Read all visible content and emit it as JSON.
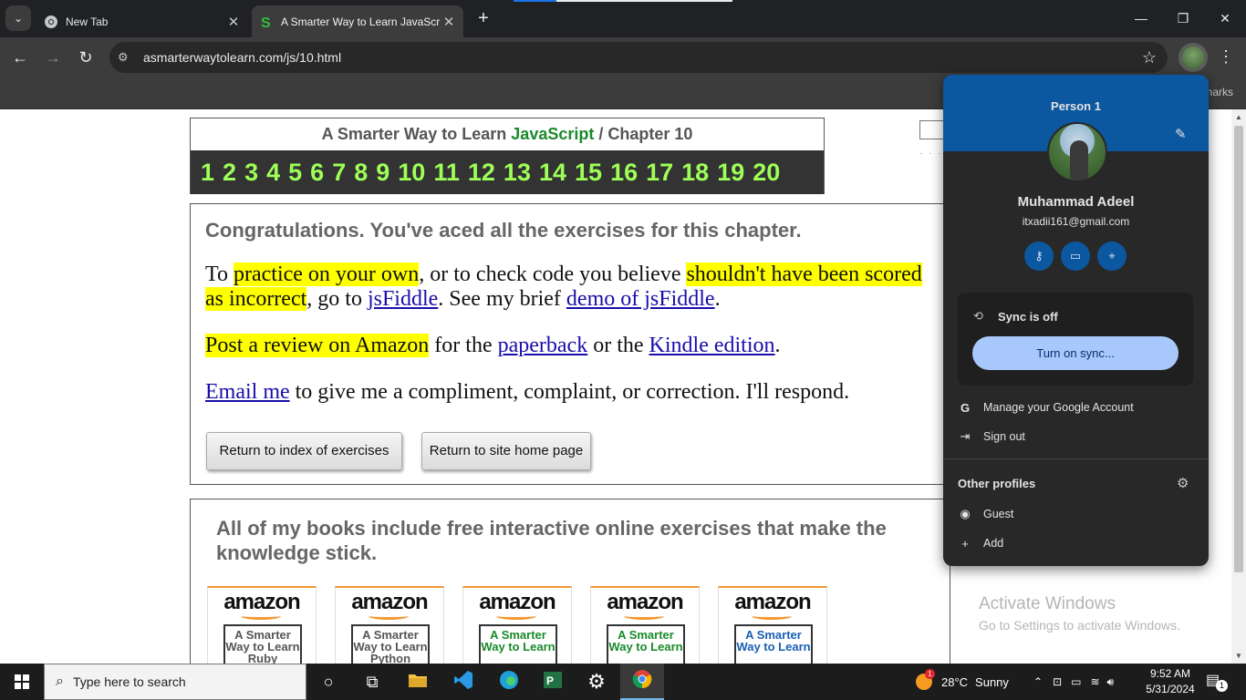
{
  "browser": {
    "tabs": [
      {
        "title": "New Tab",
        "icon": "chrome-icon"
      },
      {
        "title": "A Smarter Way to Learn JavaScript",
        "icon": "site-s-icon"
      }
    ],
    "new_tab_label": "+",
    "url": "asmarterwaytolearn.com/js/10.html",
    "bookmarks_fragment": "narks"
  },
  "page": {
    "header": {
      "prefix": "A Smarter Way to Learn ",
      "js": "JavaScript",
      "sep": " / ",
      "chapter": "Chapter 10"
    },
    "chapters": [
      "1",
      "2",
      "3",
      "4",
      "5",
      "6",
      "7",
      "8",
      "9",
      "10",
      "11",
      "12",
      "13",
      "14",
      "15",
      "16",
      "17",
      "18",
      "19",
      "20"
    ],
    "congrats": "Congratulations. You've aced all the exercises for this chapter.",
    "p1": {
      "t1": "To ",
      "h1": "practice on your own",
      "t2": ", or to check code you believe ",
      "h2": "shouldn't have been scored as incorrect",
      "t3": ", go to ",
      "l1": "jsFiddle",
      "t4": ". See my brief ",
      "l2": "demo of jsFiddle",
      "t5": "."
    },
    "p2": {
      "h1": "Post a review on Amazon",
      "t1": " for the ",
      "l1": "paperback",
      "t2": " or the ",
      "l2": "Kindle edition",
      "t3": "."
    },
    "p3": {
      "l1": "Email me",
      "t1": " to give me a compliment, complaint, or correction. I'll respond."
    },
    "buttons": {
      "index": "Return to index of exercises",
      "home": "Return to site home page"
    },
    "books_heading": "All of my books include free interactive online exercises that make the knowledge stick.",
    "books": [
      {
        "brand": "amazon",
        "cover": "A Smarter Way to Learn Ruby",
        "color": "#555555"
      },
      {
        "brand": "amazon",
        "cover": "A Smarter Way to Learn Python",
        "color": "#555555"
      },
      {
        "brand": "amazon",
        "cover": "A Smarter Way to Learn",
        "color": "#1a8a2a"
      },
      {
        "brand": "amazon",
        "cover": "A Smarter Way to Learn",
        "color": "#1a8a2a"
      },
      {
        "brand": "amazon",
        "cover": "A Smarter Way to Learn",
        "color": "#1a5fb4"
      }
    ]
  },
  "profile_menu": {
    "profile_label": "Person 1",
    "name": "Muhammad Adeel",
    "email": "itxadii161@gmail.com",
    "quick_icons": [
      "key-icon",
      "credit-card-icon",
      "location-pin-icon"
    ],
    "sync_status": "Sync is off",
    "sync_button": "Turn on sync...",
    "manage_account": "Manage your Google Account",
    "sign_out": "Sign out",
    "other_profiles": "Other profiles",
    "guest": "Guest",
    "add": "Add"
  },
  "watermark": {
    "line1": "Activate Windows",
    "line2": "Go to Settings to activate Windows."
  },
  "taskbar": {
    "search_placeholder": "Type here to search",
    "weather_temp": "28°C",
    "weather_desc": "Sunny",
    "weather_badge": "1",
    "time": "9:52 AM",
    "date": "5/31/2024",
    "notification_count": "1"
  },
  "colors": {
    "chapter_number": "#9dff57",
    "highlight": "#ffff00",
    "link": "#1a0dab",
    "popup_header": "#0b57a0",
    "sync_button": "#a8c7fa"
  }
}
